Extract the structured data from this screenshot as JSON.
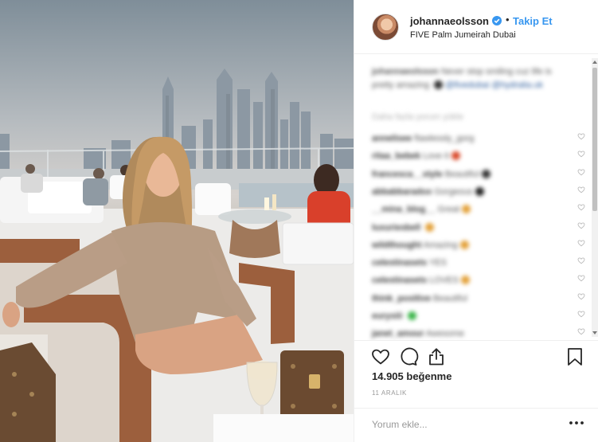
{
  "post": {
    "username": "johannaeolsson",
    "follow_label": "Takip Et",
    "separator": "•",
    "location": "FIVE Palm Jumeirah Dubai",
    "caption": {
      "author": "johannaeolsson",
      "text": "Never stop smiling cuz life is pretty amazing",
      "mentions": [
        "@fivedubai",
        "@hydralia.uk"
      ]
    },
    "view_all": "Daha fazla yorum yükle",
    "comments": [
      {
        "user": "annelisee",
        "text": "flawlessly_gorg",
        "emoji": ""
      },
      {
        "user": "ritaa_bebek",
        "text": "Love it",
        "emoji": "#d94a2b"
      },
      {
        "user": "francesca__style",
        "text": "Beautiful",
        "emoji": "#333333"
      },
      {
        "user": "abbabbaradox",
        "text": "Gorgeous",
        "emoji": "#222222"
      },
      {
        "user": "__mina_blog__",
        "text": "Great",
        "emoji": "#e3a13a"
      },
      {
        "user": "luxuriesbell",
        "text": "",
        "emoji": "#e3a13a"
      },
      {
        "user": "wildthought",
        "text": "Amazing",
        "emoji": "#e3a13a"
      },
      {
        "user": "celestinasets",
        "text": "YES",
        "emoji": ""
      },
      {
        "user": "celestinasets",
        "text": "LOVES",
        "emoji": "#e3a13a"
      },
      {
        "user": "think_positive",
        "text": "Beautiful",
        "emoji": ""
      },
      {
        "user": "eurysiii",
        "text": "",
        "emoji": "#3bb54a"
      },
      {
        "user": "janet_amour",
        "text": "Awesome",
        "emoji": ""
      }
    ],
    "likes": "14.905 beğenme",
    "date": "11 ARALIK",
    "comment_placeholder": "Yorum ekle...",
    "more_label": "•••"
  },
  "colors": {
    "accent": "#3897f0",
    "text": "#262626",
    "muted": "#999999",
    "border": "#efefef"
  },
  "icons": {
    "like": "heart-icon",
    "comment": "speech-bubble-icon",
    "share": "share-icon",
    "save": "bookmark-icon",
    "verified": "verified-badge-icon"
  }
}
